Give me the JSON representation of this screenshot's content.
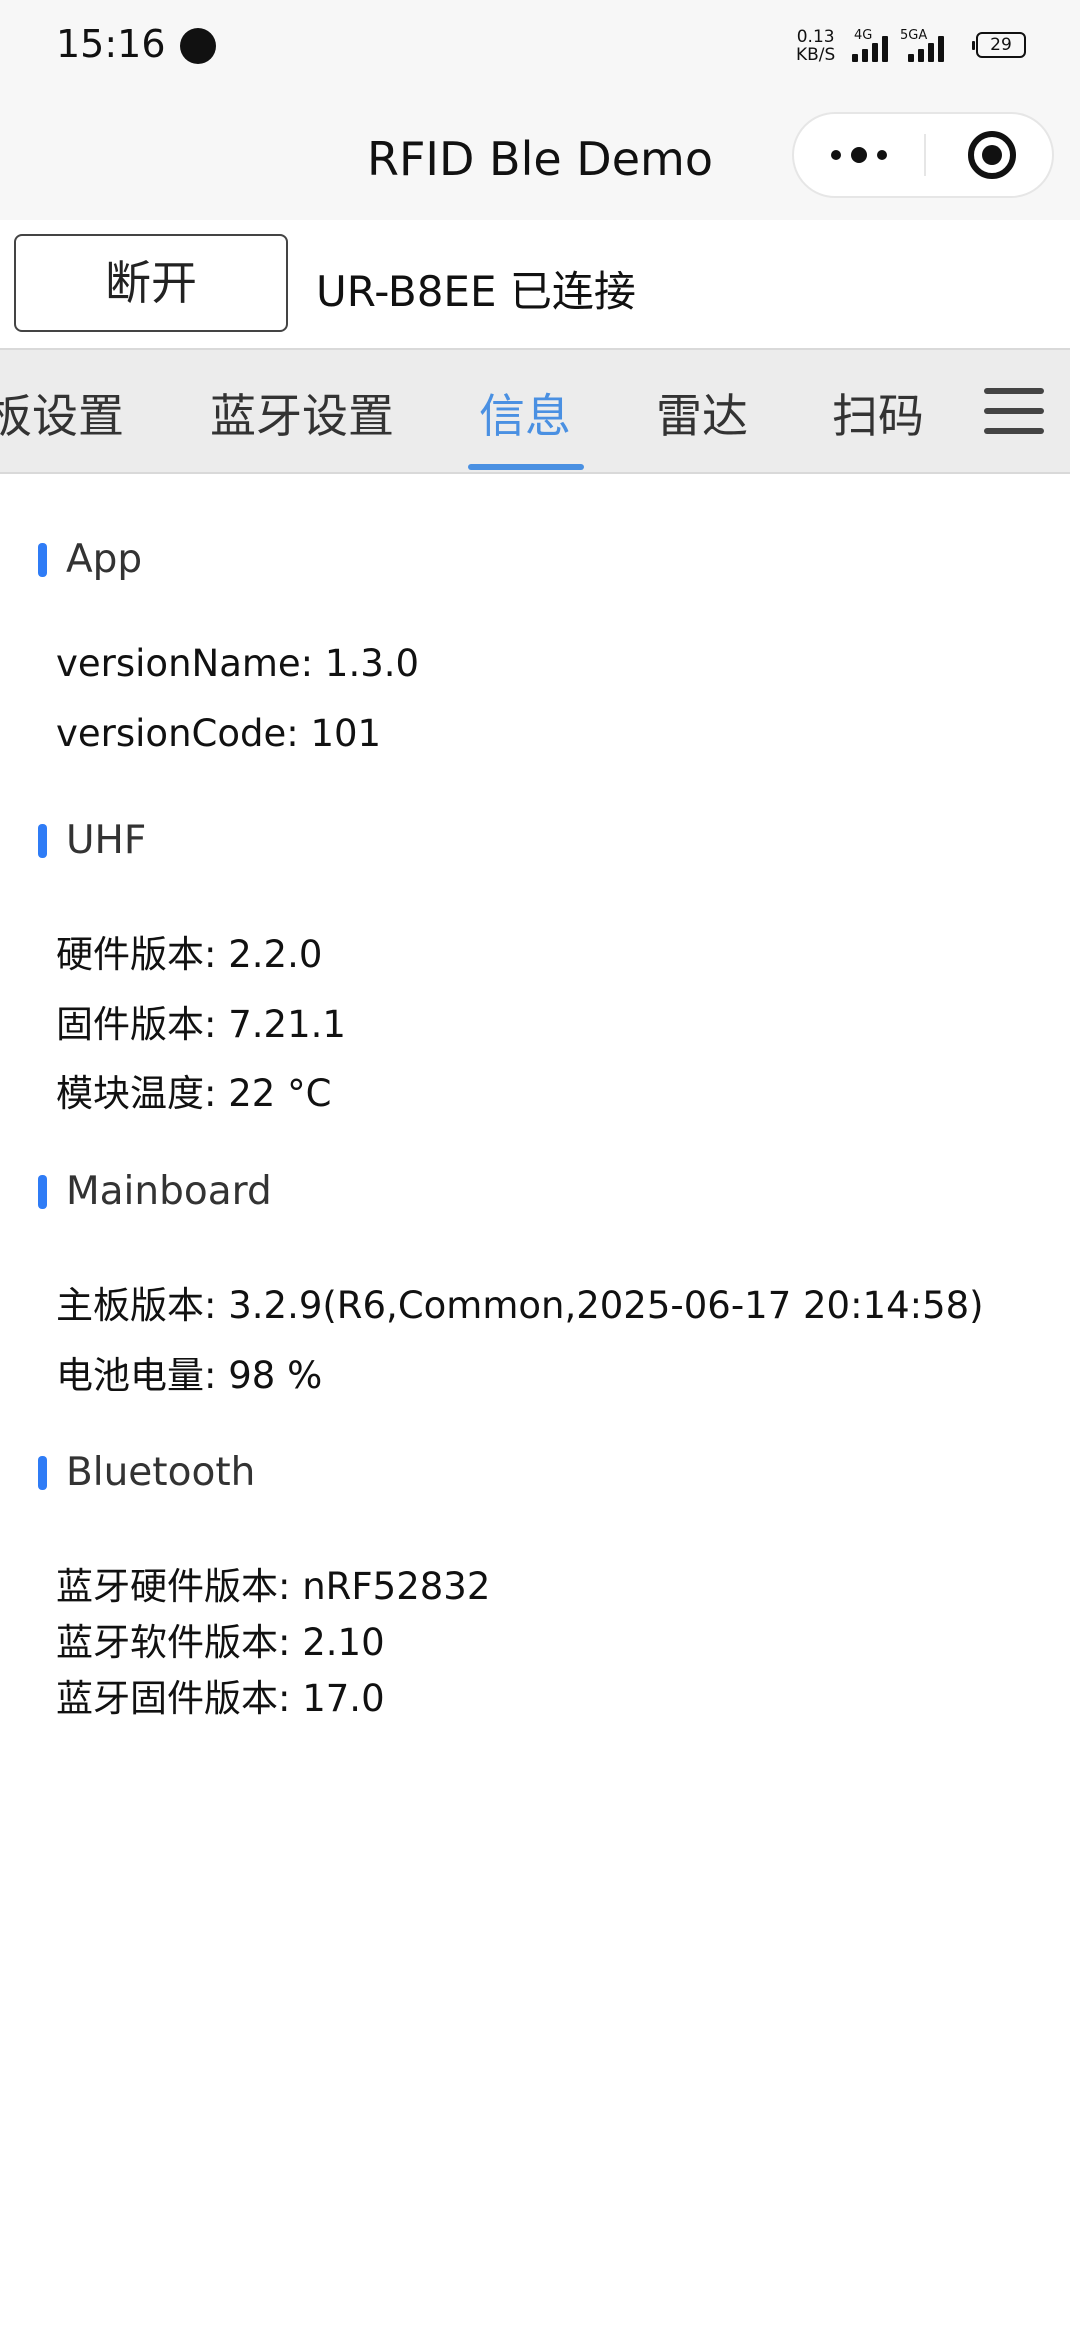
{
  "status_bar": {
    "time": "15:16",
    "net_speed_value": "0.13",
    "net_speed_unit": "KB/S",
    "sim1_label": "4G",
    "sim2_label": "5GA",
    "battery": "29"
  },
  "nav": {
    "title": "RFID Ble Demo",
    "more_icon": "more-dots-icon",
    "close_icon": "target-circle-icon"
  },
  "connection": {
    "disconnect_label": "断开",
    "status_text": "UR-B8EE 已连接"
  },
  "tabs": [
    {
      "label": "板设置",
      "active": false
    },
    {
      "label": "蓝牙设置",
      "active": false
    },
    {
      "label": "信息",
      "active": true
    },
    {
      "label": "雷达",
      "active": false
    },
    {
      "label": "扫码",
      "active": false
    }
  ],
  "accent_color": "#4a90e2",
  "section_bar_color": "#2f7cf6",
  "sections": {
    "app": {
      "title": "App",
      "lines": [
        "versionName: 1.3.0",
        "versionCode: 101"
      ]
    },
    "uhf": {
      "title": "UHF",
      "lines": [
        "硬件版本: 2.2.0",
        "固件版本: 7.21.1",
        "模块温度: 22 °C"
      ]
    },
    "mainboard": {
      "title": "Mainboard",
      "lines": [
        "主板版本: 3.2.9(R6,Common,2025-06-17 20:14:58)",
        "电池电量: 98 %"
      ]
    },
    "bluetooth": {
      "title": "Bluetooth",
      "lines": [
        "蓝牙硬件版本: nRF52832",
        "蓝牙软件版本: 2.10",
        "蓝牙固件版本: 17.0"
      ]
    }
  }
}
